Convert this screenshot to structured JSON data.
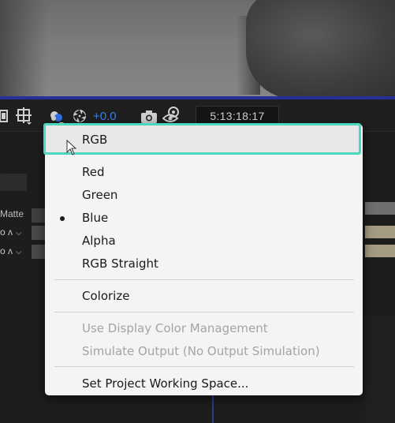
{
  "toolbar": {
    "exposure_value": "+0.0",
    "timecode": "5:13:18:17",
    "icons": [
      "fast-previews-icon",
      "grid-guides-icon",
      "channel-icon",
      "reset-exposure-icon",
      "snapshot-icon",
      "show-snapshot-icon"
    ]
  },
  "panel": {
    "matte_label": "Matte",
    "mode_label_1": "o ʌ",
    "mode_label_2": "o ʌ"
  },
  "menu": {
    "items": [
      {
        "label": "RGB",
        "selected": false,
        "enabled": true,
        "highlighted": true
      },
      {
        "label": "Red",
        "selected": false,
        "enabled": true
      },
      {
        "label": "Green",
        "selected": false,
        "enabled": true
      },
      {
        "label": "Blue",
        "selected": true,
        "enabled": true
      },
      {
        "label": "Alpha",
        "selected": false,
        "enabled": true
      },
      {
        "label": "RGB Straight",
        "selected": false,
        "enabled": true
      },
      {
        "label": "Colorize",
        "selected": false,
        "enabled": true
      },
      {
        "label": "Use Display Color Management",
        "selected": false,
        "enabled": false
      },
      {
        "label": "Simulate Output (No Output Simulation)",
        "selected": false,
        "enabled": false
      },
      {
        "label": "Set Project Working Space...",
        "selected": false,
        "enabled": true
      }
    ]
  },
  "colors": {
    "highlight_border": "#4fd6be",
    "exposure_text": "#3b7fe6",
    "menu_background": "#f4f4f4",
    "disabled_text": "#a4a4a4"
  }
}
